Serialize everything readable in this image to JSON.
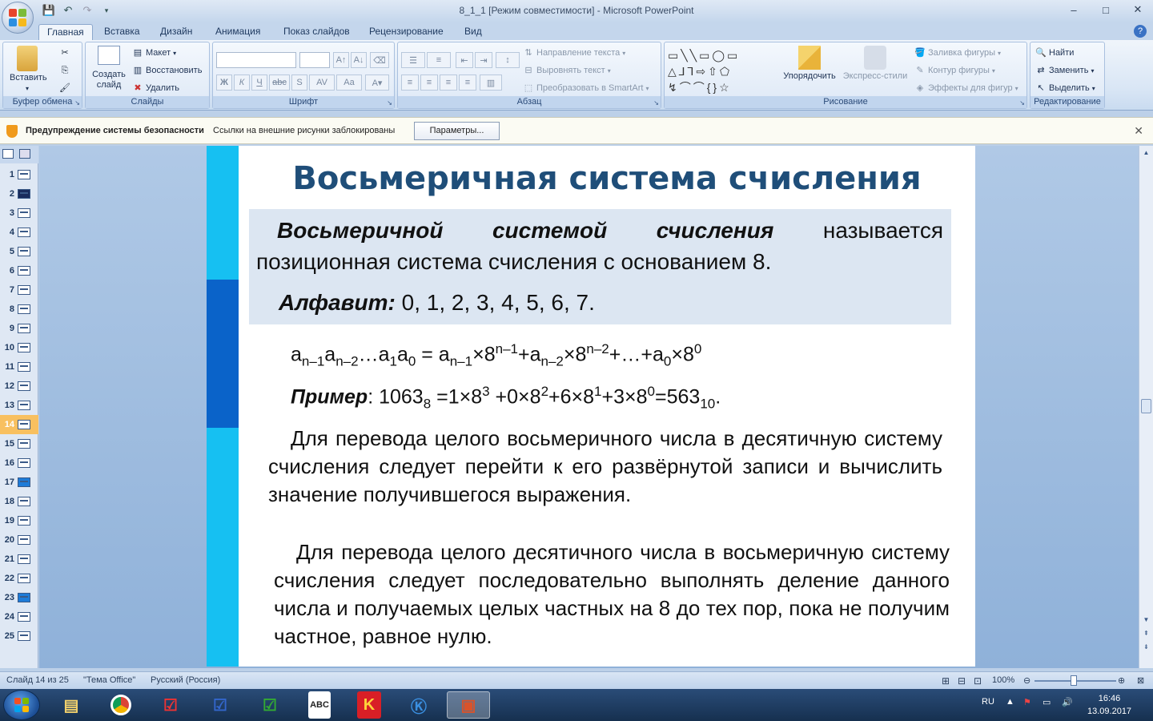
{
  "window": {
    "title": "8_1_1 [Режим совместимости] - Microsoft PowerPoint",
    "controls": [
      "–",
      "□",
      "✕"
    ]
  },
  "tabs": [
    "Главная",
    "Вставка",
    "Дизайн",
    "Анимация",
    "Показ слайдов",
    "Рецензирование",
    "Вид"
  ],
  "ribbon": {
    "clipboard": {
      "label": "Буфер обмена",
      "paste": "Вставить"
    },
    "slides": {
      "label": "Слайды",
      "new_slide": "Создать слайд",
      "layout": "Макет",
      "reset": "Восстановить",
      "delete": "Удалить"
    },
    "font": {
      "label": "Шрифт"
    },
    "paragraph": {
      "label": "Абзац",
      "text_direction": "Направление текста",
      "align_text": "Выровнять текст",
      "smartart": "Преобразовать в SmartArt"
    },
    "drawing": {
      "label": "Рисование",
      "arrange": "Упорядочить",
      "quick_styles": "Экспресс-стили",
      "shape_fill": "Заливка фигуры",
      "shape_outline": "Контур фигуры",
      "shape_effects": "Эффекты для фигур"
    },
    "editing": {
      "label": "Редактирование",
      "find": "Найти",
      "replace": "Заменить",
      "select": "Выделить"
    }
  },
  "security_bar": {
    "title": "Предупреждение системы безопасности",
    "message": "Ссылки на внешние рисунки заблокированы",
    "button": "Параметры..."
  },
  "slides_panel": {
    "numbers": [
      "1",
      "2",
      "3",
      "4",
      "5",
      "6",
      "7",
      "8",
      "9",
      "10",
      "11",
      "12",
      "13",
      "14",
      "15",
      "16",
      "17",
      "18",
      "19",
      "20",
      "21",
      "22",
      "23",
      "24",
      "25"
    ],
    "current": "14"
  },
  "slide": {
    "title": "Восьмеричная система счисления",
    "def_term": "Восьмеричной системой счисления",
    "def_rest": "называется позиционная система счисления с основанием 8.",
    "alphabet_label": "Алфавит:",
    "alphabet_value": "0, 1, 2, 3, 4, 5, 6, 7.",
    "example_label": "Пример",
    "para1": "Для перевода целого восьмеричного числа в десятичную систему счисления следует перейти к его развёрнутой записи и вычислить значение получившегося выражения.",
    "para2": "Для перевода целого десятичного числа в восьмеричную систему счисления следует последовательно выполнять деление данного числа и получаемых целых частных на 8 до тех пор, пока не получим частное, равное нулю."
  },
  "status": {
    "slide_info": "Слайд 14 из 25",
    "theme": "\"Тема Office\"",
    "language": "Русский (Россия)",
    "zoom": "100%"
  },
  "taskbar": {
    "lang": "RU",
    "time": "16:46",
    "date": "13.09.2017"
  }
}
